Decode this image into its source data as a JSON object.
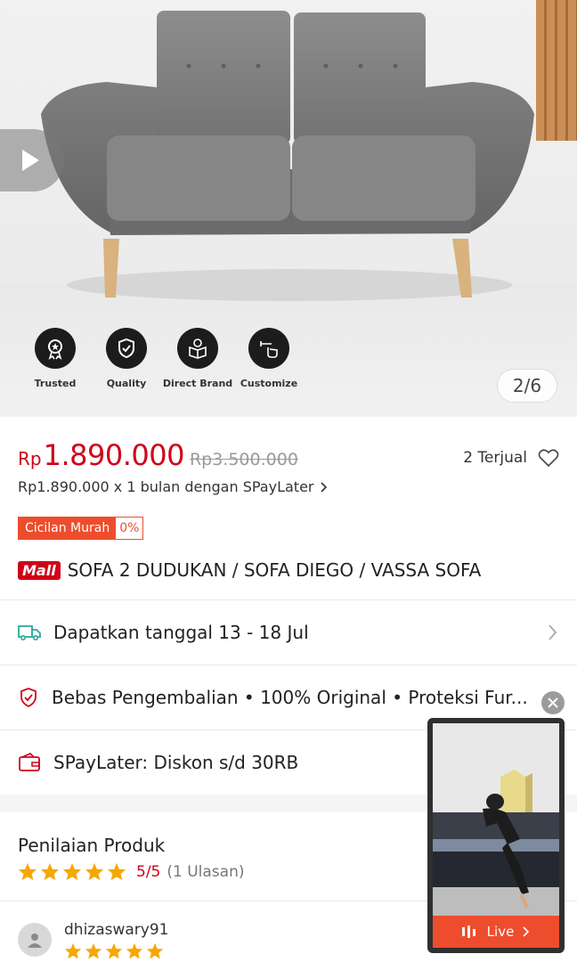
{
  "hero": {
    "badges": [
      {
        "icon": "medal-icon",
        "label": "Trusted"
      },
      {
        "icon": "shield-check-icon",
        "label": "Quality"
      },
      {
        "icon": "box-money-icon",
        "label": "Direct Brand"
      },
      {
        "icon": "hand-pointer-icon",
        "label": "Customize"
      }
    ],
    "counter": "2/6"
  },
  "price": {
    "currency": "Rp",
    "current": "1.890.000",
    "original": "Rp3.500.000",
    "sold": "2 Terjual",
    "paylater": "Rp1.890.000 x 1 bulan dengan SPayLater",
    "cicilan_label": "Cicilan Murah",
    "cicilan_rate": "0%"
  },
  "product": {
    "mall_badge": "Mall",
    "title": "SOFA 2 DUDUKAN / SOFA DIEGO / VASSA SOFA"
  },
  "info": {
    "shipping": "Dapatkan tanggal 13 - 18 Jul",
    "guarantee": "Bebas Pengembalian  •  100% Original  •  Proteksi Fur...",
    "spaylater": "SPayLater: Diskon s/d 30RB"
  },
  "rating": {
    "title": "Penilaian Produk",
    "value": "5/5",
    "count": "(1 Ulasan)",
    "stars": 5
  },
  "review": {
    "username": "dhizaswary91",
    "stars": 5
  },
  "live": {
    "label": "Live"
  },
  "colors": {
    "price_red": "#d0011b",
    "shopee_orange": "#ee4d2d",
    "star_yellow": "#f6a700",
    "teal": "#26aa99"
  }
}
